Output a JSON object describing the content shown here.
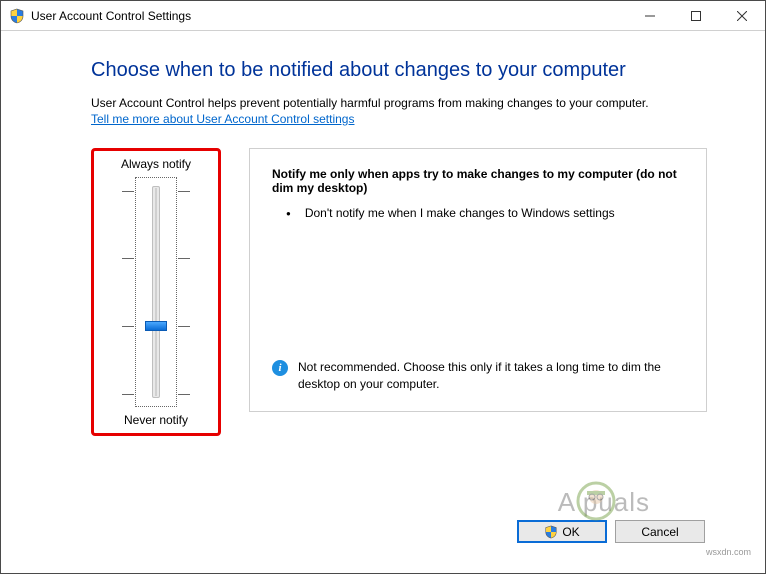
{
  "window": {
    "title": "User Account Control Settings"
  },
  "heading": "Choose when to be notified about changes to your computer",
  "subtext": "User Account Control helps prevent potentially harmful programs from making changes to your computer.",
  "link": "Tell me more about User Account Control settings",
  "slider": {
    "top_label": "Always notify",
    "bottom_label": "Never notify",
    "levels": 4,
    "selected_index": 2
  },
  "panel": {
    "title": "Notify me only when apps try to make changes to my computer (do not dim my desktop)",
    "bullets": [
      "Don't notify me when I make changes to Windows settings"
    ],
    "note": "Not recommended. Choose this only if it takes a long time to dim the desktop on your computer."
  },
  "buttons": {
    "ok": "OK",
    "cancel": "Cancel"
  },
  "watermark": "wsxdn.com",
  "appuals_text": "A   puals"
}
